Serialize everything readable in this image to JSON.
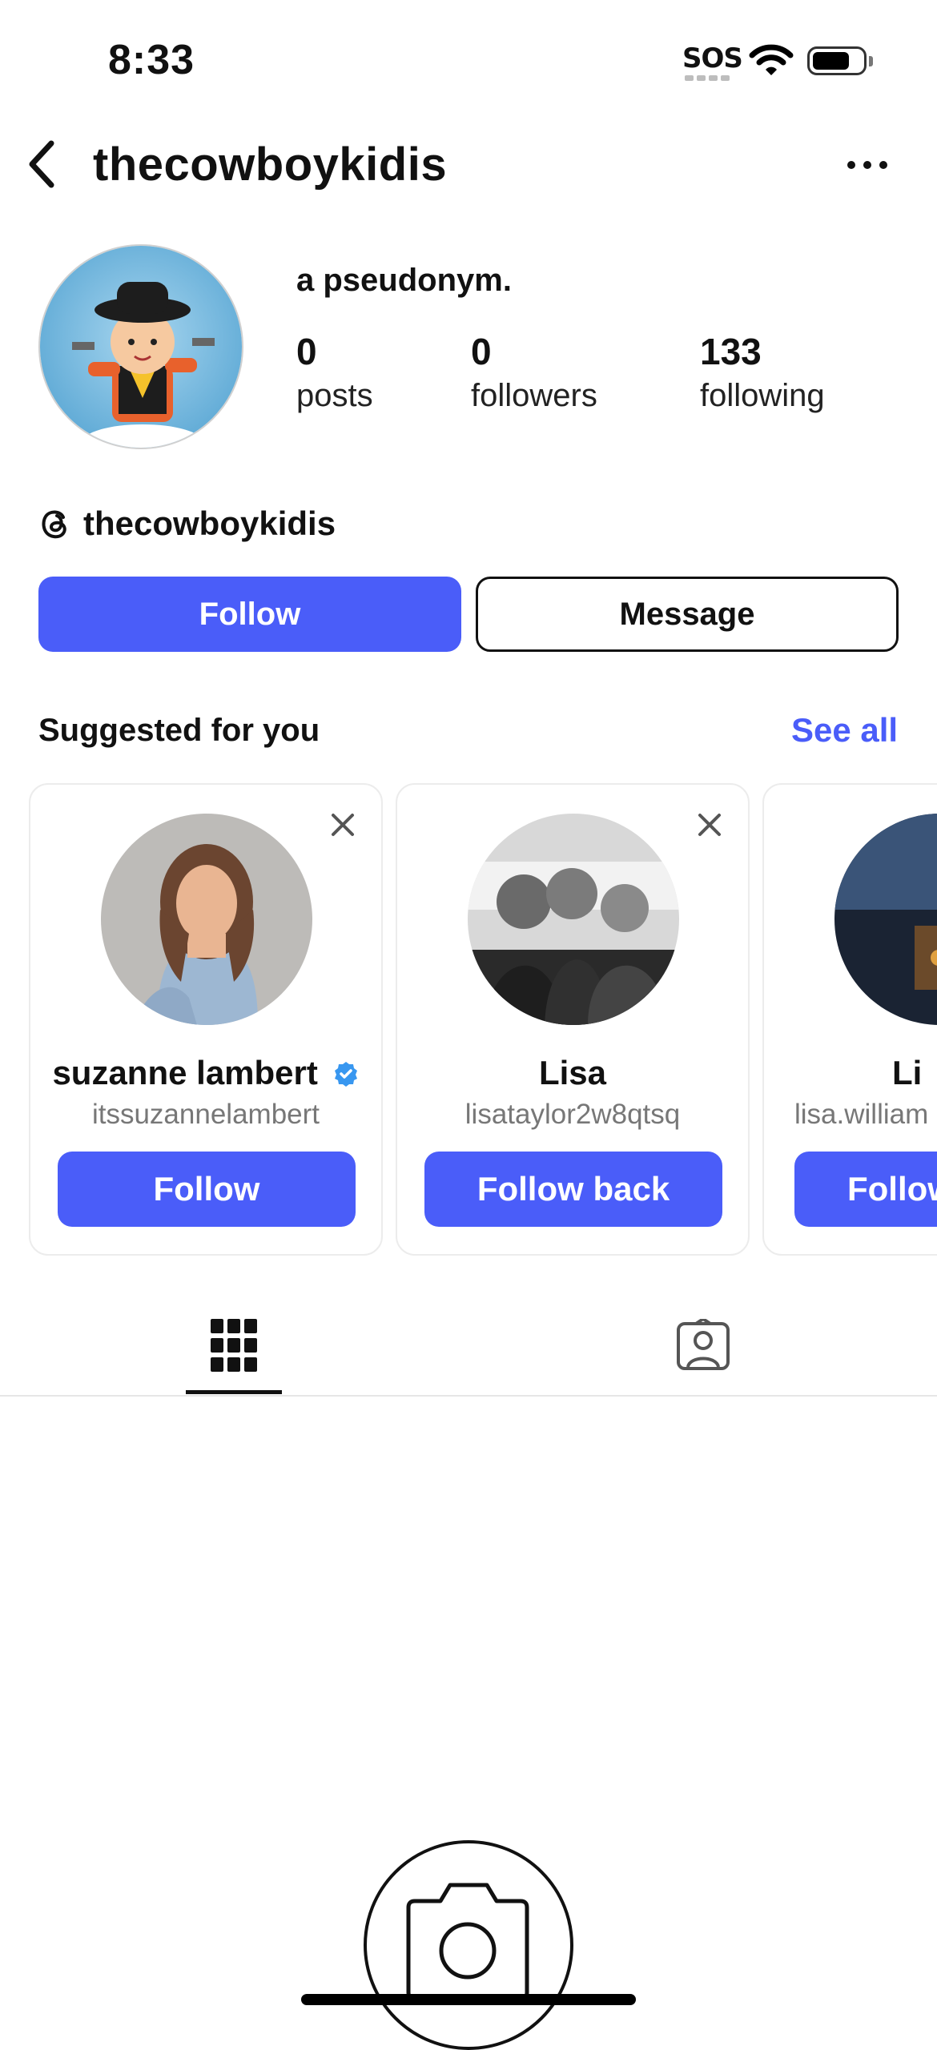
{
  "status_bar": {
    "time": "8:33",
    "sos": "SOS",
    "battery_level": 0.75
  },
  "header": {
    "username": "thecowboykidis",
    "back_icon": "chevron-left-icon",
    "more_icon": "ellipsis-icon"
  },
  "profile": {
    "bio": "a pseudonym.",
    "stats": [
      {
        "value": "0",
        "label": "posts"
      },
      {
        "value": "0",
        "label": "followers"
      },
      {
        "value": "133",
        "label": "following"
      }
    ],
    "threads_handle": "thecowboykidis"
  },
  "actions": {
    "follow": "Follow",
    "message": "Message"
  },
  "suggested": {
    "title": "Suggested for you",
    "see_all": "See all",
    "cards": [
      {
        "name": "suzanne lambert",
        "handle": "itssuzannelambert",
        "button": "Follow",
        "verified": true
      },
      {
        "name": "Lisa",
        "handle": "lisataylor2w8qtsq",
        "button": "Follow back",
        "verified": false
      },
      {
        "name": "Li",
        "handle": "lisa.william",
        "button": "Follow",
        "verified": false
      }
    ]
  },
  "tabs": [
    {
      "name": "grid",
      "icon": "grid-icon",
      "selected": true
    },
    {
      "name": "tagged",
      "icon": "tagged-person-icon",
      "selected": false
    }
  ],
  "colors": {
    "accent": "#4a5df9",
    "verified": "#3897f0"
  }
}
